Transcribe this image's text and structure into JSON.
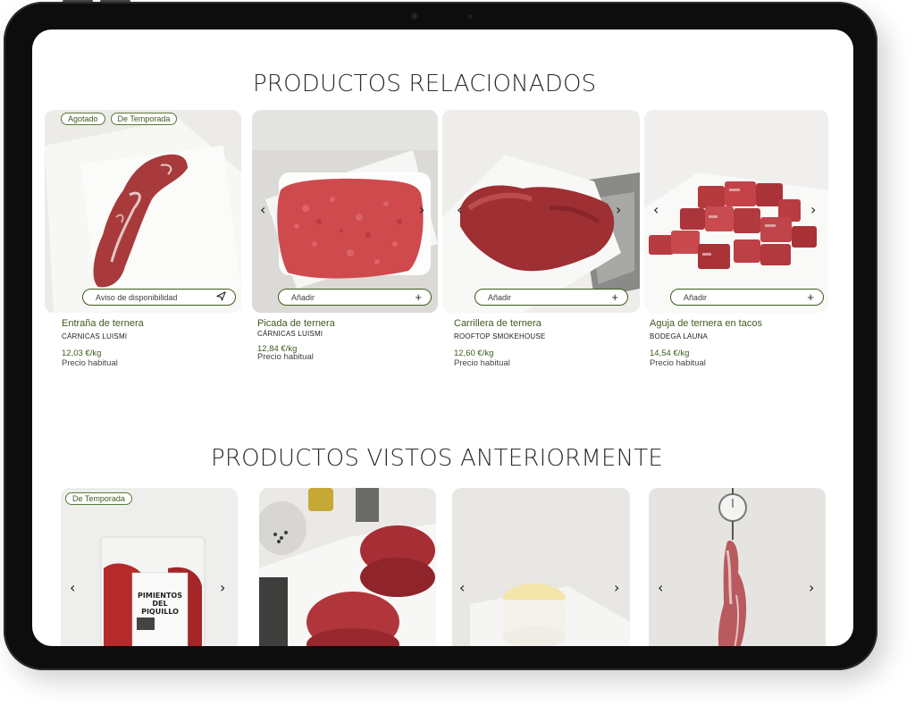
{
  "related": {
    "title": "PRODUCTOS RELACIONADOS",
    "products": [
      {
        "name": "Entraña de ternera",
        "brand": "CÁRNICAS LUISMI",
        "price": "12,03 €/kg",
        "price_note": "Precio habitual",
        "action": "Aviso de disponibilidad",
        "action_icon": "send-icon",
        "badges": [
          "Agotado",
          "De Temporada"
        ]
      },
      {
        "name": "Picada de ternera",
        "brand": "CÁRNICAS LUISMI",
        "price": "12,84 €/kg",
        "price_note": "Precio habitual",
        "action": "Añadir",
        "action_icon": "plus-icon",
        "badges": []
      },
      {
        "name": "Carrillera de ternera",
        "brand": "ROOFTOP SMOKEHOUSE",
        "price": "12,60 €/kg",
        "price_note": "Precio habitual",
        "action": "Añadir",
        "action_icon": "plus-icon",
        "badges": []
      },
      {
        "name": "Aguja de ternera en tacos",
        "brand": "BODEGA LAUNA",
        "price": "14,54 €/kg",
        "price_note": "Precio habitual",
        "action": "Añadir",
        "action_icon": "plus-icon",
        "badges": []
      }
    ]
  },
  "viewed": {
    "title": "PRODUCTOS VISTOS ANTERIORMENTE",
    "products": [
      {
        "badges": [
          "De Temporada"
        ],
        "package_text": [
          "PIMIENTOS",
          "DEL PIQUILLO"
        ]
      },
      {
        "badges": []
      },
      {
        "badges": []
      },
      {
        "badges": []
      }
    ]
  },
  "icons": {
    "prev": "chevron-left-icon",
    "next": "chevron-right-icon"
  },
  "colors": {
    "accent_green": "#3e5a1e",
    "text_dark": "#2c2c2c",
    "device_frame": "#0d0d0d"
  }
}
